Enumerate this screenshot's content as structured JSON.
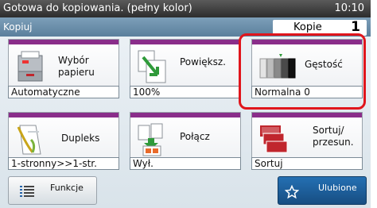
{
  "status_bar": {
    "message": "Gotowa do kopiowania. (pełny kolor)",
    "time": "10:10"
  },
  "title_bar": {
    "title": "Kopiuj",
    "copies_label": "Kopie",
    "copies_value": "1"
  },
  "tiles": [
    {
      "label": "Wybór papieru",
      "value": "Automatyczne",
      "icon": "paper-tray-icon"
    },
    {
      "label": "Powiększ.",
      "value": "100%",
      "icon": "zoom-icon"
    },
    {
      "label": "Gęstość",
      "value": "Normalna 0",
      "icon": "density-icon"
    },
    {
      "label": "Dupleks",
      "value": "1-stronny>>1-str.",
      "icon": "duplex-icon"
    },
    {
      "label": "Połącz",
      "value": "Wył.",
      "icon": "combine-icon"
    },
    {
      "label": "Sortuj/ przesun.",
      "value": "Sortuj",
      "icon": "collate-icon"
    }
  ],
  "bottom": {
    "functions_label": "Funkcje",
    "favorites_label": "Ulubione"
  },
  "colors": {
    "accent_purple": "#8a2d8a",
    "highlight_red": "#e0151c",
    "favorites_blue": "#1f63a3"
  }
}
